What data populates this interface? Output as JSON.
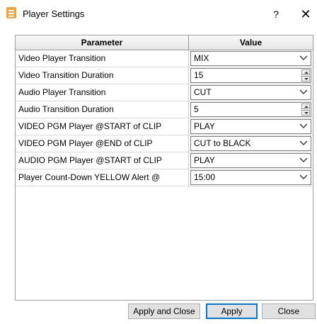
{
  "window": {
    "title": "Player Settings",
    "help": "?",
    "close": "✕"
  },
  "table": {
    "headers": {
      "parameter": "Parameter",
      "value": "Value"
    },
    "rows": [
      {
        "param": "Video Player Transition",
        "value": "MIX",
        "control": "combo"
      },
      {
        "param": "Video Transition Duration",
        "value": "15",
        "control": "spin"
      },
      {
        "param": "Audio Player Transition",
        "value": "CUT",
        "control": "combo"
      },
      {
        "param": "Audio Transition Duration",
        "value": "5",
        "control": "spin"
      },
      {
        "param": "VIDEO PGM Player @START of CLIP",
        "value": "PLAY",
        "control": "combo"
      },
      {
        "param": "VIDEO PGM Player @END of CLIP",
        "value": "CUT to BLACK",
        "control": "combo"
      },
      {
        "param": "AUDIO PGM Player @START of CLIP",
        "value": "PLAY",
        "control": "combo"
      },
      {
        "param": "Player Count-Down YELLOW Alert @",
        "value": "15:00",
        "control": "combo"
      }
    ]
  },
  "buttons": {
    "apply_close": "Apply and Close",
    "apply": "Apply",
    "close": "Close"
  },
  "icons": {
    "app": "settings-list-icon",
    "chevron": "chevron-down-icon",
    "spin": "spin-arrows-icon"
  },
  "colors": {
    "app_icon": "#f2a13a",
    "focus_border": "#0078d7",
    "button_face": "#e1e1e1"
  }
}
